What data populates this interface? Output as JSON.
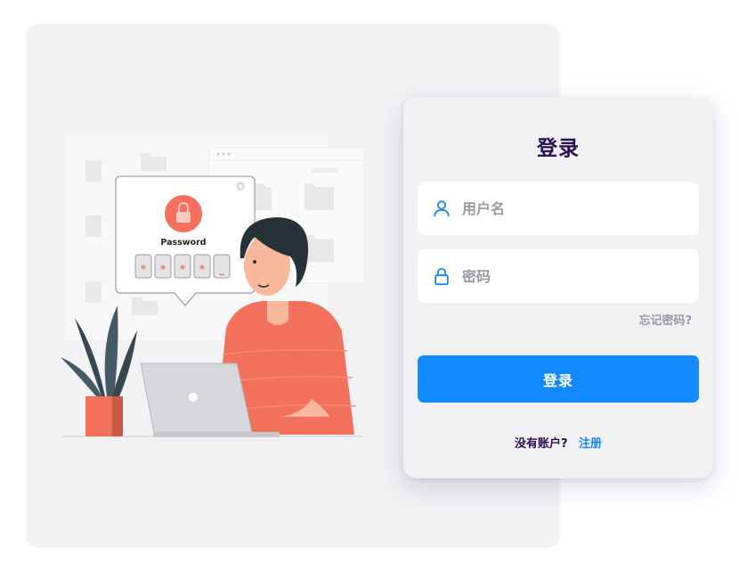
{
  "illustration": {
    "password_label": "Password",
    "password_chars": [
      "*",
      "*",
      "*",
      "*",
      "_"
    ]
  },
  "login": {
    "title": "登录",
    "username_placeholder": "用户名",
    "password_placeholder": "密码",
    "forgot_label": "忘记密码?",
    "submit_label": "登录",
    "no_account_text": "没有账户?",
    "register_label": "注册"
  },
  "colors": {
    "accent": "#1289fd",
    "title": "#2a0d52",
    "illustration_accent": "#f2705c"
  }
}
